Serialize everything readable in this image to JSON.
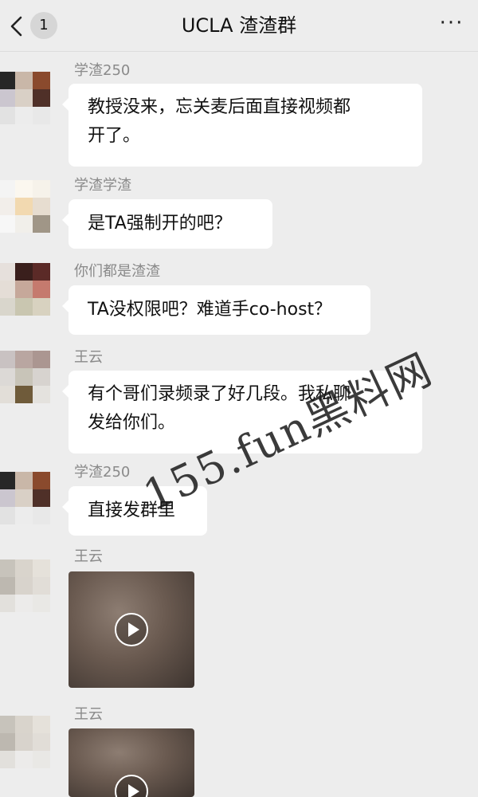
{
  "header": {
    "unread_count": "1",
    "title": "UCLA 渣渣群",
    "more_label": "···"
  },
  "messages": [
    {
      "sender": "学渣250",
      "text_lines": [
        "教授没来，忘关麦后面直接视频都",
        "开了。"
      ]
    },
    {
      "sender": "学渣学渣",
      "text_lines": [
        "是TA强制开的吧？"
      ]
    },
    {
      "sender": "你们都是渣渣",
      "text_lines": [
        "TA没权限吧？难道手co-host？"
      ]
    },
    {
      "sender": "王云",
      "text_lines": [
        "有个哥们录频录了好几段。我私聊",
        "发给你们。"
      ]
    },
    {
      "sender": "学渣250",
      "text_lines": [
        "直接发群里"
      ]
    },
    {
      "sender": "王云",
      "type": "video"
    },
    {
      "sender": "王云",
      "type": "video"
    }
  ],
  "watermark": "155.fun黑料网",
  "colors": {
    "background": "#ededed",
    "bubble": "#ffffff",
    "sender_name": "#8a8a8a"
  }
}
